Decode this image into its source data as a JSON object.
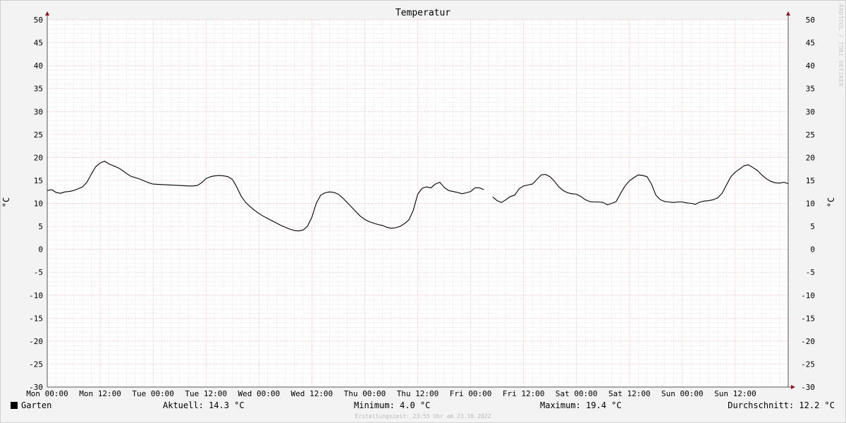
{
  "chart_data": {
    "type": "line",
    "title": "Temperatur",
    "ylabel": "°C",
    "ylim": [
      -30,
      50
    ],
    "yticks": [
      50,
      45,
      40,
      35,
      30,
      25,
      20,
      15,
      10,
      5,
      0,
      -5,
      -10,
      -15,
      -20,
      -25,
      -30
    ],
    "xlim_hours": [
      0,
      168
    ],
    "xticks": [
      {
        "hour": 0,
        "label": "Mon 00:00"
      },
      {
        "hour": 12,
        "label": "Mon 12:00"
      },
      {
        "hour": 24,
        "label": "Tue 00:00"
      },
      {
        "hour": 36,
        "label": "Tue 12:00"
      },
      {
        "hour": 48,
        "label": "Wed 00:00"
      },
      {
        "hour": 60,
        "label": "Wed 12:00"
      },
      {
        "hour": 72,
        "label": "Thu 00:00"
      },
      {
        "hour": 84,
        "label": "Thu 12:00"
      },
      {
        "hour": 96,
        "label": "Fri 00:00"
      },
      {
        "hour": 108,
        "label": "Fri 12:00"
      },
      {
        "hour": 120,
        "label": "Sat 00:00"
      },
      {
        "hour": 132,
        "label": "Sat 12:00"
      },
      {
        "hour": 144,
        "label": "Sun 00:00"
      },
      {
        "hour": 156,
        "label": "Sun 12:00"
      }
    ],
    "grid": true,
    "series": [
      {
        "name": "Garten",
        "color": "#000000",
        "segments": [
          [
            [
              0,
              12.8
            ],
            [
              1,
              13.0
            ],
            [
              2,
              12.4
            ],
            [
              3,
              12.2
            ],
            [
              4,
              12.5
            ],
            [
              5,
              12.6
            ],
            [
              6,
              12.8
            ],
            [
              7,
              13.2
            ],
            [
              8,
              13.6
            ],
            [
              9,
              14.6
            ],
            [
              10,
              16.4
            ],
            [
              11,
              18.0
            ],
            [
              12,
              18.8
            ],
            [
              13,
              19.2
            ],
            [
              14,
              18.6
            ],
            [
              15,
              18.2
            ],
            [
              16,
              17.8
            ],
            [
              17,
              17.2
            ],
            [
              18,
              16.5
            ],
            [
              19,
              15.9
            ],
            [
              20,
              15.6
            ],
            [
              21,
              15.3
            ],
            [
              22,
              14.9
            ],
            [
              23,
              14.5
            ],
            [
              24,
              14.2
            ],
            [
              26,
              14.1
            ],
            [
              28,
              14.0
            ],
            [
              30,
              13.9
            ],
            [
              32,
              13.8
            ],
            [
              33,
              13.8
            ],
            [
              34,
              13.9
            ],
            [
              35,
              14.5
            ],
            [
              36,
              15.4
            ],
            [
              37,
              15.8
            ],
            [
              38,
              16.0
            ],
            [
              39,
              16.1
            ],
            [
              40,
              16.0
            ],
            [
              41,
              15.8
            ],
            [
              42,
              15.2
            ],
            [
              43,
              13.5
            ],
            [
              44,
              11.5
            ],
            [
              45,
              10.2
            ],
            [
              46,
              9.3
            ],
            [
              47,
              8.5
            ],
            [
              48,
              7.8
            ],
            [
              49,
              7.2
            ],
            [
              50,
              6.7
            ],
            [
              51,
              6.2
            ],
            [
              52,
              5.7
            ],
            [
              53,
              5.2
            ],
            [
              54,
              4.8
            ],
            [
              55,
              4.4
            ],
            [
              56,
              4.1
            ],
            [
              57,
              4.0
            ],
            [
              58,
              4.2
            ],
            [
              59,
              5.0
            ],
            [
              60,
              7.0
            ],
            [
              61,
              10.0
            ],
            [
              62,
              11.8
            ],
            [
              63,
              12.3
            ],
            [
              64,
              12.5
            ],
            [
              65,
              12.4
            ],
            [
              66,
              12.0
            ],
            [
              67,
              11.2
            ],
            [
              68,
              10.2
            ],
            [
              69,
              9.2
            ],
            [
              70,
              8.2
            ],
            [
              71,
              7.2
            ],
            [
              72,
              6.5
            ],
            [
              73,
              6.0
            ],
            [
              74,
              5.7
            ],
            [
              75,
              5.4
            ],
            [
              76,
              5.2
            ],
            [
              77,
              4.8
            ],
            [
              78,
              4.6
            ],
            [
              79,
              4.7
            ],
            [
              80,
              5.0
            ],
            [
              81,
              5.6
            ],
            [
              82,
              6.4
            ],
            [
              83,
              8.5
            ],
            [
              84,
              12.0
            ],
            [
              85,
              13.3
            ],
            [
              86,
              13.6
            ],
            [
              87,
              13.4
            ],
            [
              88,
              14.2
            ],
            [
              89,
              14.6
            ],
            [
              90,
              13.5
            ],
            [
              91,
              12.8
            ],
            [
              92,
              12.6
            ],
            [
              93,
              12.4
            ],
            [
              94,
              12.1
            ],
            [
              95,
              12.3
            ],
            [
              96,
              12.6
            ],
            [
              97,
              13.4
            ],
            [
              98,
              13.4
            ],
            [
              99,
              13.0
            ]
          ],
          [
            [
              101,
              11.4
            ],
            [
              102,
              10.6
            ],
            [
              103,
              10.2
            ],
            [
              104,
              10.8
            ],
            [
              105,
              11.5
            ],
            [
              106,
              11.8
            ],
            [
              107,
              13.2
            ],
            [
              108,
              13.8
            ],
            [
              109,
              14.0
            ],
            [
              110,
              14.2
            ],
            [
              111,
              15.2
            ],
            [
              112,
              16.2
            ],
            [
              113,
              16.3
            ],
            [
              114,
              15.8
            ],
            [
              115,
              14.8
            ],
            [
              116,
              13.6
            ],
            [
              117,
              12.8
            ],
            [
              118,
              12.3
            ],
            [
              119,
              12.1
            ],
            [
              120,
              12.0
            ],
            [
              121,
              11.5
            ],
            [
              122,
              10.8
            ],
            [
              123,
              10.4
            ],
            [
              124,
              10.3
            ],
            [
              125,
              10.3
            ],
            [
              126,
              10.2
            ],
            [
              127,
              9.7
            ],
            [
              128,
              10.0
            ],
            [
              129,
              10.4
            ],
            [
              130,
              12.2
            ],
            [
              131,
              13.8
            ],
            [
              132,
              14.9
            ],
            [
              133,
              15.6
            ],
            [
              134,
              16.2
            ],
            [
              135,
              16.1
            ],
            [
              136,
              15.8
            ],
            [
              137,
              14.2
            ],
            [
              138,
              11.8
            ],
            [
              139,
              10.8
            ],
            [
              140,
              10.4
            ],
            [
              141,
              10.3
            ],
            [
              142,
              10.2
            ],
            [
              143,
              10.3
            ],
            [
              144,
              10.3
            ],
            [
              145,
              10.1
            ],
            [
              146,
              10.0
            ],
            [
              147,
              9.8
            ],
            [
              148,
              10.3
            ],
            [
              149,
              10.5
            ],
            [
              150,
              10.6
            ],
            [
              151,
              10.8
            ],
            [
              152,
              11.2
            ],
            [
              153,
              12.2
            ],
            [
              154,
              14.0
            ],
            [
              155,
              15.8
            ],
            [
              156,
              16.8
            ],
            [
              157,
              17.5
            ],
            [
              158,
              18.2
            ],
            [
              159,
              18.4
            ],
            [
              160,
              17.8
            ],
            [
              161,
              17.2
            ],
            [
              162,
              16.2
            ],
            [
              163,
              15.4
            ],
            [
              164,
              14.8
            ],
            [
              165,
              14.5
            ],
            [
              166,
              14.4
            ],
            [
              167,
              14.6
            ],
            [
              168,
              14.3
            ]
          ]
        ]
      }
    ]
  },
  "legend": {
    "series_label": "Garten",
    "current": "Aktuell: 14.3 °C",
    "minimum": "Minimum: 4.0 °C",
    "maximum": "Maximum: 19.4 °C",
    "average": "Durchschnitt: 12.2 °C"
  },
  "footer": "Erstellungszeit: 23:55 Uhr am 23.10.2022",
  "credit": "RRDTOOL / TOBI OETIKER"
}
